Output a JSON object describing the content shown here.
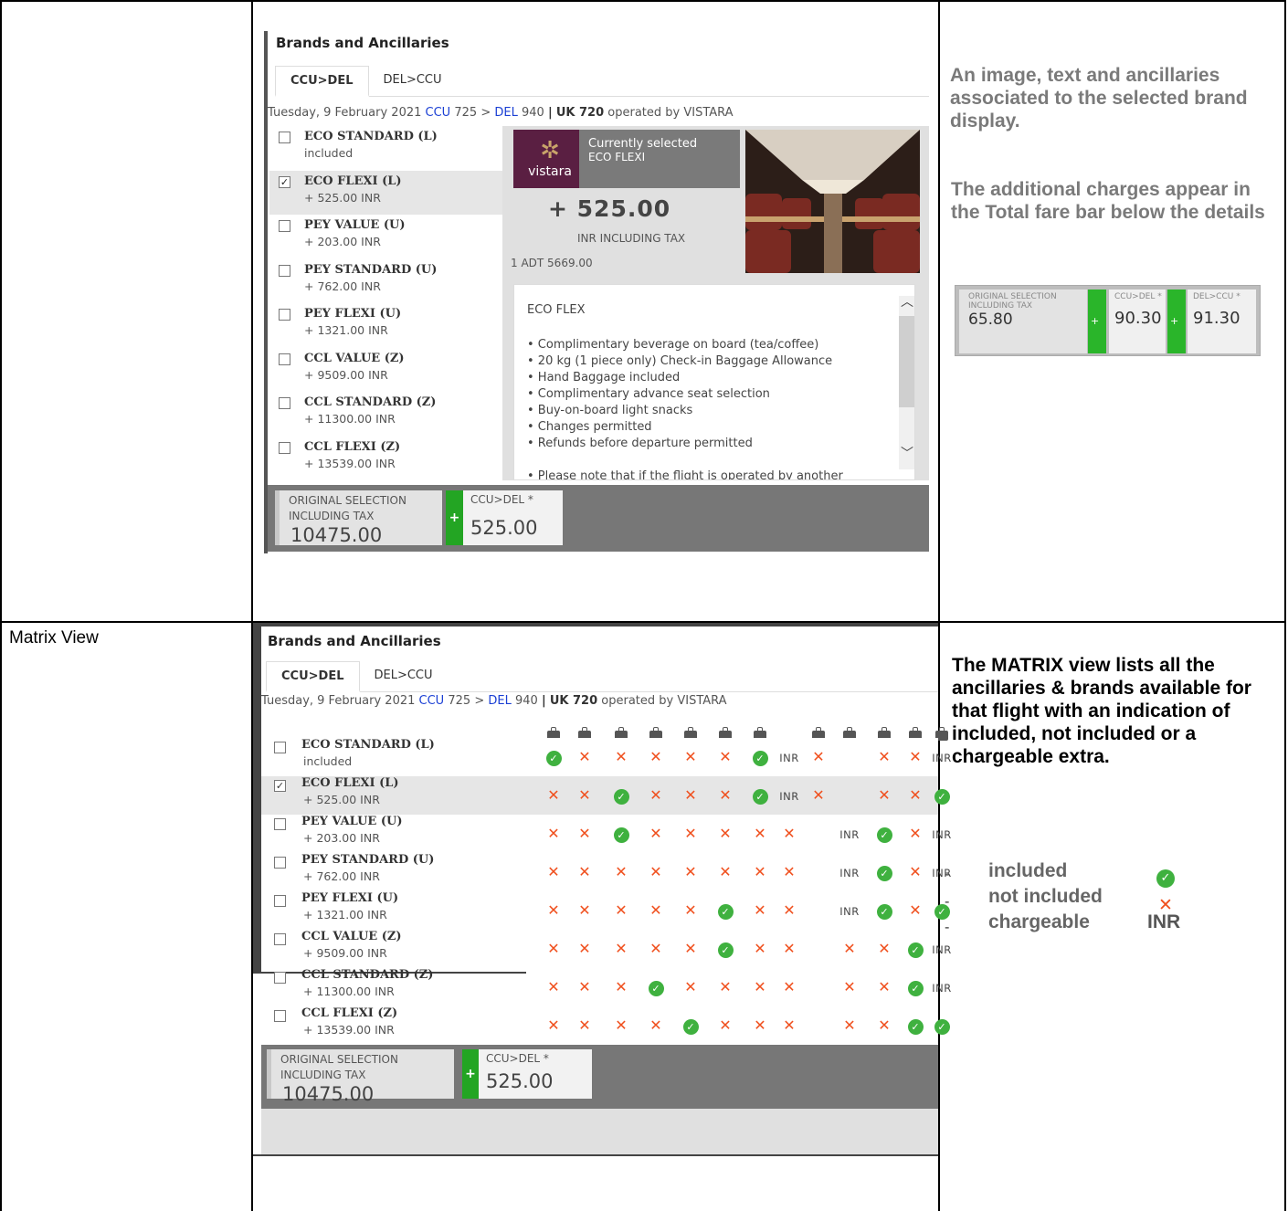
{
  "table": {
    "row2_label": "Matrix View"
  },
  "top_panel": {
    "title": "Brands and Ancillaries",
    "tabs": [
      "CCU>DEL",
      "DEL>CCU"
    ],
    "flight_line": {
      "date": "Tuesday, 9 February 2021",
      "origin": "CCU",
      "dep": "725",
      "arrow": ">",
      "dest": "DEL",
      "arr": "940",
      "sep": "|",
      "flight": "UK 720",
      "operated": "operated by VISTARA"
    },
    "brands": [
      {
        "name": "ECO STANDARD (L)",
        "price": "included",
        "checked": false
      },
      {
        "name": "ECO FLEXI (L)",
        "price": "+ 525.00  INR",
        "checked": true
      },
      {
        "name": "PEY VALUE (U)",
        "price": "+ 203.00  INR",
        "checked": false
      },
      {
        "name": "PEY STANDARD (U)",
        "price": "+ 762.00  INR",
        "checked": false
      },
      {
        "name": "PEY FLEXI (U)",
        "price": "+ 1321.00  INR",
        "checked": false
      },
      {
        "name": "CCL VALUE (Z)",
        "price": "+ 9509.00  INR",
        "checked": false
      },
      {
        "name": "CCL STANDARD (Z)",
        "price": "+ 11300.00  INR",
        "checked": false
      },
      {
        "name": "CCL FLEXI (Z)",
        "price": "+ 13539.00  INR",
        "checked": false
      }
    ],
    "detail": {
      "logo_text": "vistara",
      "currently_selected": "Currently selected",
      "selected_brand": "ECO FLEXI",
      "price": "+ 525.00",
      "price_sub": "INR INCLUDING TAX",
      "adt": "1 ADT 5669.00",
      "desc_title": "ECO FLEX",
      "desc_items": [
        "• Complimentary beverage on board (tea/coffee)",
        "• 20 kg (1 piece only) Check-in Baggage Allowance",
        "• Hand Baggage included",
        "• Complimentary advance seat selection",
        "• Buy-on-board light snacks",
        "• Changes permitted",
        "• Refunds before departure permitted",
        "",
        "• Please note that if the flight is operated by another"
      ]
    },
    "fare_bar": {
      "orig_label1": "ORIGINAL SELECTION",
      "orig_label2": "INCLUDING TAX",
      "orig_value": "10475.00",
      "plus": "+",
      "seg_label": "CCU>DEL *",
      "seg_value": "525.00"
    }
  },
  "notes": {
    "top_1": "An image, text and ancillaries associated to the selected brand display.",
    "top_2": "The additional charges appear in the Total fare bar below the details",
    "matrix": "The MATRIX view lists all the ancillaries & brands available for that flight with an indication of included, not included or a chargeable extra."
  },
  "mini_bar": {
    "orig_label1": "ORIGINAL SELECTION",
    "orig_label2": "INCLUDING TAX",
    "orig_value": "65.80",
    "seg1_label": "CCU>DEL *",
    "seg1_value": "90.30",
    "seg2_label": "DEL>CCU *",
    "seg2_value": "91.30",
    "plus": "+"
  },
  "matrix_panel": {
    "title": "Brands and Ancillaries",
    "tabs": [
      "CCU>DEL",
      "DEL>CCU"
    ],
    "flight_line": {
      "date": "Tuesday, 9 February 2021",
      "origin": "CCU",
      "dep": "725",
      "arrow": ">",
      "dest": "DEL",
      "arr": "940",
      "sep": "|",
      "flight": "UK 720",
      "operated": "operated by VISTARA"
    },
    "brands": [
      {
        "name": "ECO STANDARD (L)",
        "price": "included",
        "checked": false,
        "cells": [
          "c",
          "x",
          "x",
          "x",
          "x",
          "x",
          "c",
          "i",
          "x",
          "",
          "x",
          "x",
          "i"
        ]
      },
      {
        "name": "ECO FLEXI (L)",
        "price": "+ 525.00  INR",
        "checked": true,
        "cells": [
          "x",
          "x",
          "c",
          "x",
          "x",
          "x",
          "c",
          "i",
          "x",
          "",
          "x",
          "x",
          "c"
        ]
      },
      {
        "name": "PEY VALUE (U)",
        "price": "+ 203.00  INR",
        "checked": false,
        "cells": [
          "x",
          "x",
          "c",
          "x",
          "x",
          "x",
          "x",
          "x",
          "",
          "i",
          "c",
          "x",
          "i"
        ]
      },
      {
        "name": "PEY STANDARD (U)",
        "price": "+ 762.00  INR",
        "checked": false,
        "cells": [
          "x",
          "x",
          "x",
          "x",
          "x",
          "x",
          "x",
          "x",
          "",
          "i",
          "c",
          "x",
          "i"
        ]
      },
      {
        "name": "PEY FLEXI (U)",
        "price": "+ 1321.00  INR",
        "checked": false,
        "cells": [
          "x",
          "x",
          "x",
          "x",
          "x",
          "c",
          "x",
          "x",
          "",
          "i",
          "c",
          "x",
          "c"
        ]
      },
      {
        "name": "CCL VALUE (Z)",
        "price": "+ 9509.00  INR",
        "checked": false,
        "cells": [
          "x",
          "x",
          "x",
          "x",
          "x",
          "c",
          "x",
          "x",
          "",
          "x",
          "x",
          "c",
          "i"
        ]
      },
      {
        "name": "CCL STANDARD (Z)",
        "price": "+ 11300.00  INR",
        "checked": false,
        "cells": [
          "x",
          "x",
          "x",
          "c",
          "x",
          "x",
          "x",
          "x",
          "",
          "x",
          "x",
          "c",
          "i"
        ]
      },
      {
        "name": "CCL FLEXI (Z)",
        "price": "+ 13539.00  INR",
        "checked": false,
        "cells": [
          "x",
          "x",
          "x",
          "x",
          "c",
          "x",
          "x",
          "x",
          "",
          "x",
          "x",
          "c",
          "c"
        ]
      }
    ],
    "fare_bar": {
      "orig_label1": "ORIGINAL SELECTION",
      "orig_label2": "INCLUDING TAX",
      "orig_value": "10475.00",
      "plus": "+",
      "seg_label": "CCU>DEL *",
      "seg_value": "525.00"
    }
  },
  "legend": {
    "included": "included",
    "not_included": "not included",
    "chargeable": "chargeable",
    "inr": "INR",
    "dash": "-"
  },
  "icons": {
    "included": "check-circle-icon",
    "not_included": "cross-icon",
    "bag": "bag-icon"
  },
  "colors": {
    "included_green": "#3fb13f",
    "cross_orange": "#f0501e",
    "link_blue": "#1a3fd4",
    "vistara_purple": "#5a1f42"
  }
}
